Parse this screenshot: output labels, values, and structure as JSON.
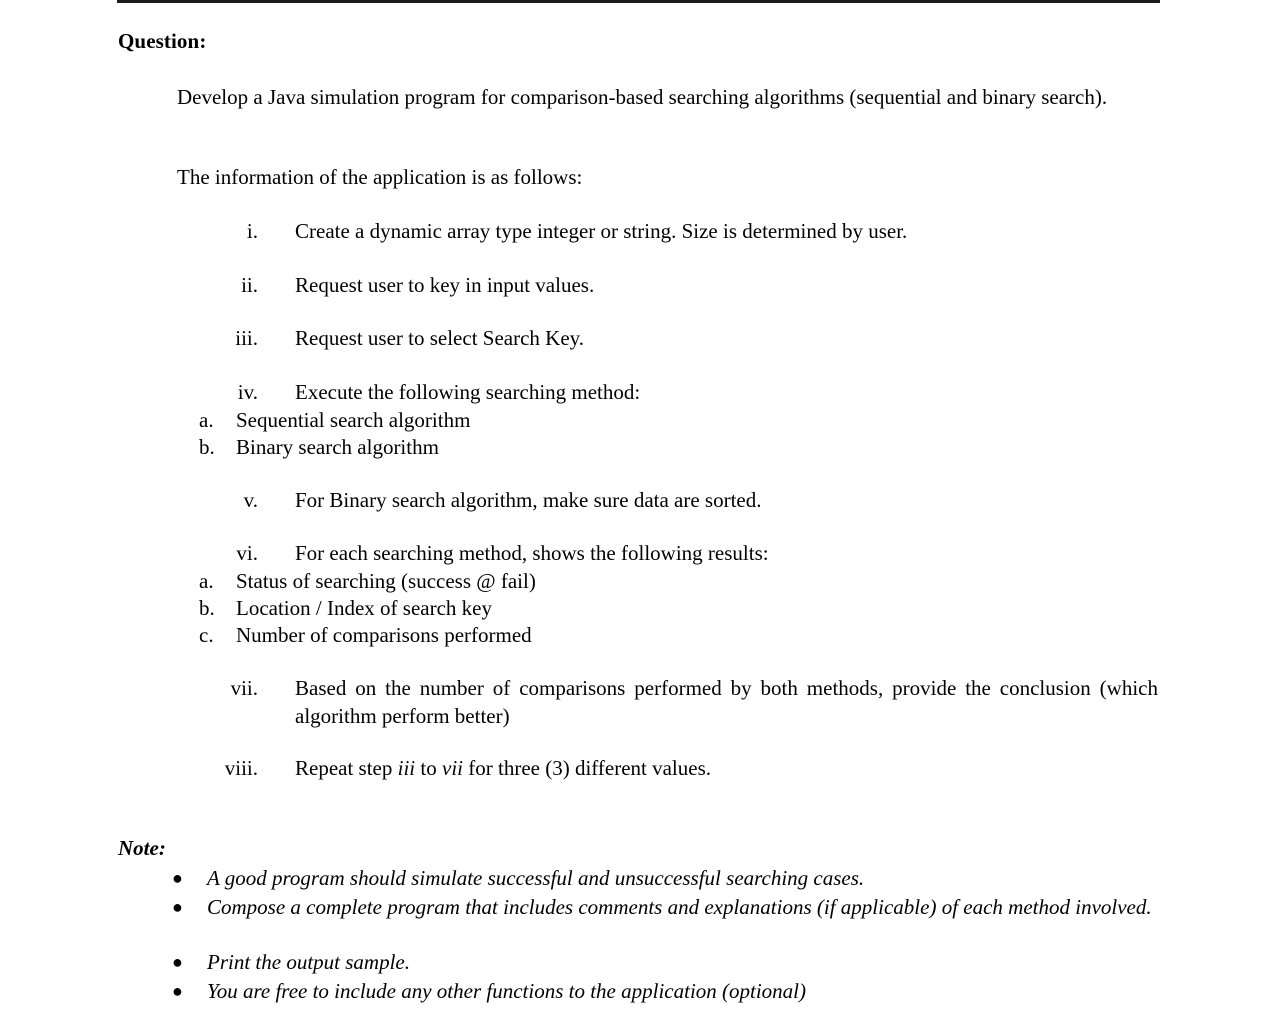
{
  "document": {
    "heading": "Question:",
    "intro_paragraph": "Develop a Java simulation program for comparison-based searching algorithms (sequential and binary search).",
    "follows_line": "The information of the application is as follows:",
    "items": [
      {
        "marker": "i.",
        "text": "Create a dynamic array type integer or string. Size is determined by user.",
        "subitems": []
      },
      {
        "marker": "ii.",
        "text": "Request user to key in input values.",
        "subitems": []
      },
      {
        "marker": "iii.",
        "text": "Request user to select Search Key.",
        "subitems": []
      },
      {
        "marker": "iv.",
        "text": "Execute the following searching method:",
        "subitems": [
          {
            "marker": "a.",
            "text": "Sequential search algorithm"
          },
          {
            "marker": "b.",
            "text": "Binary search algorithm"
          }
        ]
      },
      {
        "marker": "v.",
        "text": "For Binary search algorithm, make sure data are sorted.",
        "subitems": []
      },
      {
        "marker": "vi.",
        "text": "For each searching method, shows the following results:",
        "subitems": [
          {
            "marker": "a.",
            "text": "Status of searching (success @ fail)"
          },
          {
            "marker": "b.",
            "text": "Location / Index of search key"
          },
          {
            "marker": "c.",
            "text": "Number of comparisons performed"
          }
        ]
      },
      {
        "marker": "vii.",
        "text": "Based on the number of comparisons performed by both methods, provide the conclusion (which algorithm perform better)",
        "subitems": []
      },
      {
        "marker": "viii.",
        "text_prefix": "Repeat step ",
        "text_ref1": "iii",
        "text_mid": " to ",
        "text_ref2": "vii",
        "text_suffix": " for three (3) different values.",
        "text": "Repeat step iii to vii for three (3) different values.",
        "subitems": []
      }
    ],
    "note": {
      "heading": "Note:",
      "bullet_glyph": "●",
      "bullets": [
        "A good program should simulate successful and unsuccessful searching cases.",
        "Compose a complete program that includes comments and explanations (if applicable) of each method involved.",
        "Print the output sample.",
        "You are free to include any other functions to the application (optional)"
      ]
    }
  },
  "style": {
    "text_color": "#000000",
    "background_color": "#ffffff",
    "rule_color": "#1c1c1c"
  }
}
